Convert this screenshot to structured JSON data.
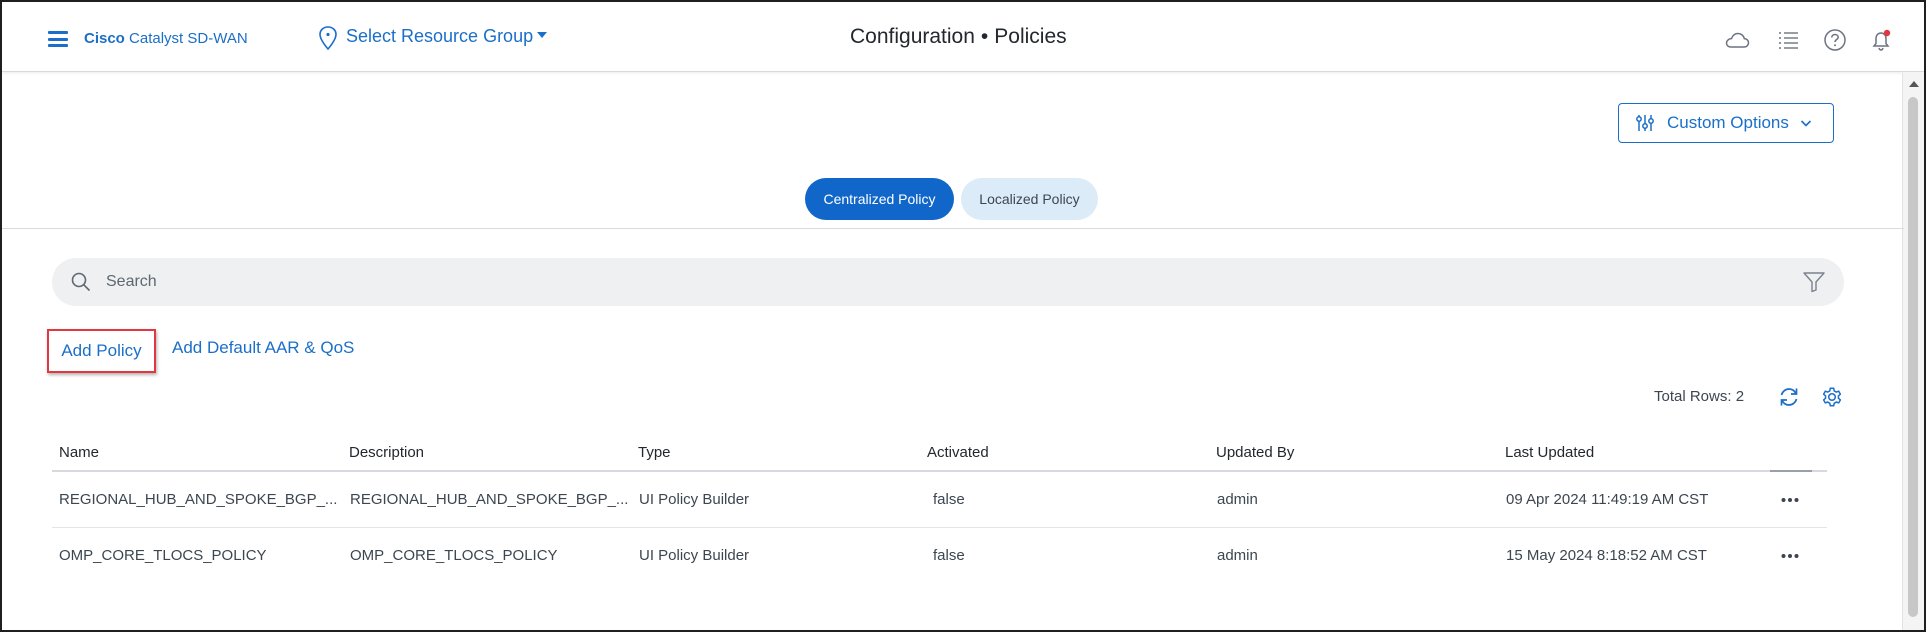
{
  "header": {
    "brand_bold": "Cisco",
    "brand_rest": " Catalyst SD-WAN",
    "resource_group": "Select Resource Group",
    "title_section": "Configuration",
    "title_separator": "•",
    "title_page": "Policies"
  },
  "icons": {
    "menu": "hamburger-menu-icon",
    "location": "location-pin-icon",
    "cloud": "cloud-icon",
    "tasks": "list-icon",
    "help": "help-icon",
    "notifications": "bell-icon",
    "notification_dot_color": "#e0383e"
  },
  "toolbar": {
    "custom_options_label": "Custom Options"
  },
  "tabs": [
    {
      "label": "Centralized Policy",
      "active": true
    },
    {
      "label": "Localized Policy",
      "active": false
    }
  ],
  "search": {
    "placeholder": "Search",
    "value": ""
  },
  "actions": {
    "add_policy": "Add Policy",
    "add_default": "Add Default AAR & QoS"
  },
  "table": {
    "total_rows_label": "Total Rows: 2",
    "columns": [
      "Name",
      "Description",
      "Type",
      "Activated",
      "Updated By",
      "Last Updated"
    ],
    "rows": [
      {
        "name": "REGIONAL_HUB_AND_SPOKE_BGP_...",
        "description": "REGIONAL_HUB_AND_SPOKE_BGP_...",
        "type": "UI Policy Builder",
        "activated": "false",
        "updated_by": "admin",
        "last_updated": "09 Apr 2024 11:49:19 AM CST"
      },
      {
        "name": "OMP_CORE_TLOCS_POLICY",
        "description": "OMP_CORE_TLOCS_POLICY",
        "type": "UI Policy Builder",
        "activated": "false",
        "updated_by": "admin",
        "last_updated": "15 May 2024 8:18:52 AM CST"
      }
    ]
  },
  "colors": {
    "accent": "#1b6fc8",
    "active_tab": "#1067c9",
    "inactive_tab": "#dcebf8",
    "highlight_box": "#e0383e"
  }
}
